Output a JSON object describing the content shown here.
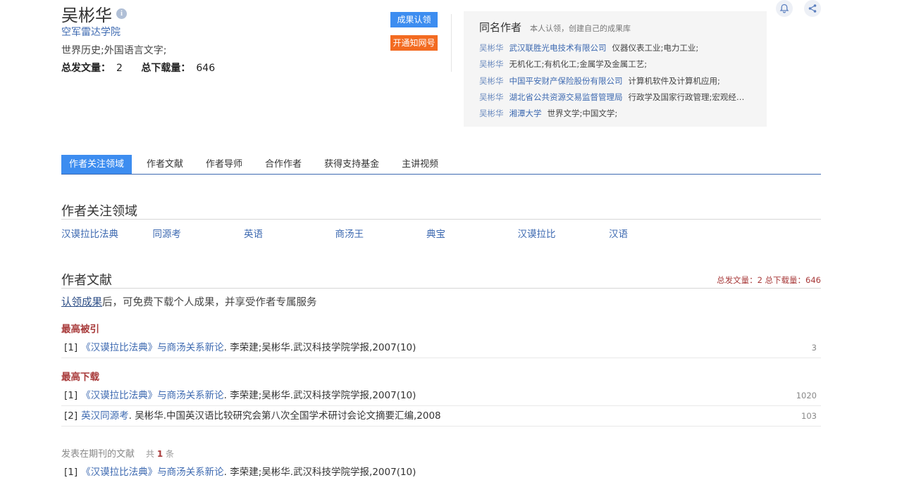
{
  "author": {
    "name": "吴彬华",
    "affiliation": "空军雷达学院",
    "subjects": "世界历史;外国语言文字;",
    "total_pubs_label": "总发文量：",
    "total_pubs": "2",
    "total_downloads_label": "总下载量：",
    "total_downloads": "646"
  },
  "actions": {
    "claim": "成果认领",
    "open_cnki": "开通知网号"
  },
  "same_name": {
    "title": "同名作者",
    "hint": "本人认领，创建自己的成果库",
    "items": [
      {
        "name": "吴彬华",
        "org": "武汉联胜光电技术有限公司",
        "field": "仪器仪表工业;电力工业;"
      },
      {
        "name": "吴彬华",
        "org": "",
        "field": "无机化工;有机化工;金属学及金属工艺;"
      },
      {
        "name": "吴彬华",
        "org": "中国平安财产保险股份有限公司",
        "field": "计算机软件及计算机应用;"
      },
      {
        "name": "吴彬华",
        "org": "湖北省公共资源交易监督管理局",
        "field": "行政学及国家行政管理;宏观经济管理与可持续发展;"
      },
      {
        "name": "吴彬华",
        "org": "湘潭大学",
        "field": "世界文学;中国文学;"
      }
    ]
  },
  "tabs": [
    "作者关注领域",
    "作者文献",
    "作者导师",
    "合作作者",
    "获得支持基金",
    "主讲视频"
  ],
  "focus": {
    "title": "作者关注领域",
    "keywords": [
      "汉谟拉比法典",
      "同源考",
      "英语",
      "商汤王",
      "典宝",
      "汉谟拉比",
      "汉语"
    ]
  },
  "docs": {
    "title": "作者文献",
    "summary": "总发文量：2 总下载量：646",
    "claim_link": "认领成果",
    "claim_rest": "后，可免费下载个人成果，并享受作者专属服务",
    "most_cited_title": "最高被引",
    "most_cited": [
      {
        "idx": "[1]",
        "title": "《汉谟拉比法典》与商汤关系新论",
        "meta": ". 李荣建;吴彬华.武汉科技学院学报,2007(10)",
        "count": "3"
      }
    ],
    "most_downloaded_title": "最高下载",
    "most_downloaded": [
      {
        "idx": "[1]",
        "title": "《汉谟拉比法典》与商汤关系新论",
        "meta": ". 李荣建;吴彬华.武汉科技学院学报,2007(10)",
        "count": "1020"
      },
      {
        "idx": "[2]",
        "title": "英汉同源考",
        "meta": ". 吴彬华.中国英汉语比较研究会第八次全国学术研讨会论文摘要汇编,2008",
        "count": "103"
      }
    ],
    "journal_title": "发表在期刊的文献",
    "journal_total_prefix": "共",
    "journal_total": "1",
    "journal_total_suffix": "条",
    "journal": [
      {
        "idx": "[1]",
        "title": "《汉谟拉比法典》与商汤关系新论",
        "meta": ". 李荣建;吴彬华.武汉科技学院学报,2007(10)"
      }
    ]
  },
  "icons": {
    "info": "info-icon",
    "bell": "bell-icon",
    "share": "share-icon"
  },
  "colors": {
    "accent": "#3d8df0",
    "orange": "#f36b21",
    "link": "#3e6ab1",
    "highlight": "#a83a3a"
  }
}
